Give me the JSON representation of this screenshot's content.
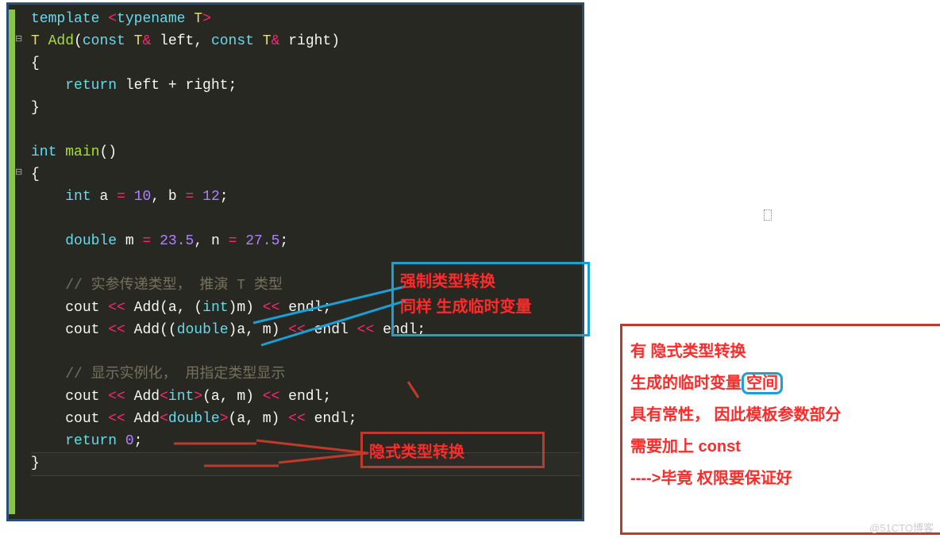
{
  "code": {
    "l1": {
      "template": "template",
      "open": "<",
      "typename": "typename",
      "T": "T",
      "close": ">"
    },
    "l2": {
      "T": "T",
      "fn": "Add",
      "open": "(",
      "const1": "const",
      "T1": "T",
      "amp1": "&",
      "left": "left",
      "comma": ",",
      "const2": "const",
      "T2": "T",
      "amp2": "&",
      "right": "right",
      "close": ")"
    },
    "l3": "{",
    "l4": {
      "ret": "return",
      "expr": "left + right",
      "semi": ";"
    },
    "l5": "}",
    "l6": {
      "int": "int",
      "fn": "main",
      "parens": "()"
    },
    "l7": "{",
    "l8": {
      "int": "int",
      "a": "a",
      "eq1": "=",
      "v1": "10",
      "comma": ",",
      "b": "b",
      "eq2": "=",
      "v2": "12",
      "semi": ";"
    },
    "l9": {
      "double": "double",
      "m": "m",
      "eq1": "=",
      "v1": "23.5",
      "comma": ",",
      "n": "n",
      "eq2": "=",
      "v2": "27.5",
      "semi": ";"
    },
    "cmt1": "// 实参传递类型， 推演 T 类型",
    "l10": {
      "cout": "cout",
      "s1": "<<",
      "fn": "Add",
      "open": "(",
      "a": "a",
      "comma": ",",
      "cast_open": "(",
      "int": "int",
      "cast_close": ")",
      "m": "m",
      "close": ")",
      "s2": "<<",
      "endl": "endl",
      "semi": ";"
    },
    "l11": {
      "cout": "cout",
      "s1": "<<",
      "fn": "Add",
      "open": "((",
      "double": "double",
      "close1": ")",
      "a": "a",
      "comma": ",",
      "m": "m",
      "close2": ")",
      "s2": "<<",
      "endl1": "endl",
      "s3": "<<",
      "endl2": "endl",
      "semi": ";"
    },
    "cmt2": "// 显示实例化， 用指定类型显示",
    "l12": {
      "cout": "cout",
      "s1": "<<",
      "fn": "Add",
      "lt": "<",
      "int": "int",
      "gt": ">",
      "args": "(a, m)",
      "s2": "<<",
      "endl": "endl",
      "semi": ";"
    },
    "l13": {
      "cout": "cout",
      "s1": "<<",
      "fn": "Add",
      "lt": "<",
      "double": "double",
      "gt": ">",
      "args": "(a, m)",
      "s2": "<<",
      "endl": "endl",
      "semi": ";"
    },
    "l14": {
      "ret": "return",
      "v": "0",
      "semi": ";"
    },
    "l15": "}"
  },
  "annotations": {
    "box1_line1": "强制类型转换",
    "box1_line2": "同样 生成临时变量",
    "box2": "隐式类型转换",
    "box3_l1": "有 隐式类型转换",
    "box3_l2a": "生成的临时变量",
    "box3_l2b": "空间",
    "box3_l3": "具有常性， 因此模板参数部分",
    "box3_l4": "需要加上 const",
    "box3_l5": "---->毕竟 权限要保证好"
  },
  "watermark": "@51CTO博客"
}
